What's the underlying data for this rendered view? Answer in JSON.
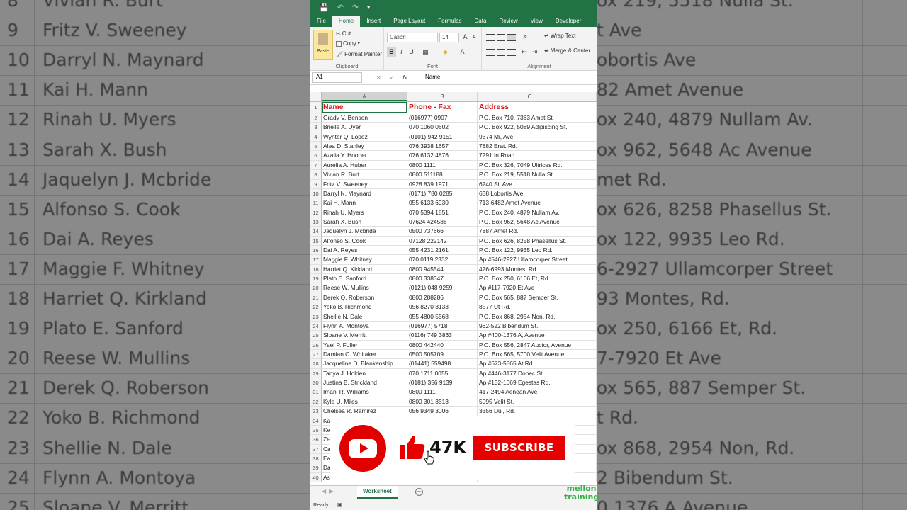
{
  "backdrop": {
    "left_rows": [
      {
        "num": "8",
        "name": "Vivian R. Burt"
      },
      {
        "num": "9",
        "name": "Fritz V. Sweeney"
      },
      {
        "num": "10",
        "name": "Darryl N. Maynard"
      },
      {
        "num": "11",
        "name": "Kai H. Mann"
      },
      {
        "num": "12",
        "name": "Rinah U. Myers"
      },
      {
        "num": "13",
        "name": "Sarah X. Bush"
      },
      {
        "num": "14",
        "name": "Jaquelyn J. Mcbride"
      },
      {
        "num": "15",
        "name": "Alfonso S. Cook"
      },
      {
        "num": "16",
        "name": "Dai A. Reyes"
      },
      {
        "num": "17",
        "name": "Maggie F. Whitney"
      },
      {
        "num": "18",
        "name": "Harriet Q. Kirkland"
      },
      {
        "num": "19",
        "name": "Plato E. Sanford"
      },
      {
        "num": "20",
        "name": "Reese W. Mullins"
      },
      {
        "num": "21",
        "name": "Derek Q. Roberson"
      },
      {
        "num": "22",
        "name": "Yoko B. Richmond"
      },
      {
        "num": "23",
        "name": "Shellie N. Dale"
      },
      {
        "num": "24",
        "name": "Flynn A. Montoya"
      },
      {
        "num": "25",
        "name": "Sloane V. Merritt"
      }
    ],
    "right_rows": [
      "ox 219, 5518 Nulla St.",
      "t Ave",
      "obortis Ave",
      "82 Amet Avenue",
      "ox 240, 4879 Nullam Av.",
      "ox 962, 5648 Ac Avenue",
      "met Rd.",
      "ox 626, 8258 Phasellus St.",
      "ox 122, 9935 Leo Rd.",
      "6-2927 Ullamcorper Street",
      "93 Montes, Rd.",
      "ox 250, 6166 Et, Rd.",
      "7-7920 Et Ave",
      "ox 565, 887 Semper St.",
      "t Rd.",
      "ox 868, 2954 Non, Rd.",
      "2 Bibendum St.",
      "0 1376 A Avenue"
    ]
  },
  "excel": {
    "tabs": [
      "File",
      "Home",
      "Insert",
      "Page Layout",
      "Formulas",
      "Data",
      "Review",
      "View",
      "Developer"
    ],
    "active_tab": "Home",
    "clipboard": {
      "paste": "Paste",
      "cut": "Cut",
      "copy": "Copy",
      "format_painter": "Format Painter",
      "label": "Clipboard"
    },
    "font": {
      "name": "Calibri",
      "size": "14",
      "label": "Font",
      "bold": "B",
      "italic": "I",
      "underline": "U"
    },
    "alignment": {
      "wrap": "Wrap Text",
      "merge": "Merge & Center",
      "label": "Alignment"
    },
    "namebox": "A1",
    "formula": "Name",
    "fx": "fx",
    "columns": [
      "A",
      "B",
      "C"
    ],
    "header_row": {
      "num": "1",
      "a": "Name",
      "b": "Phone - Fax",
      "c": "Address"
    },
    "rows": [
      {
        "num": "2",
        "a": "Grady V. Benson",
        "b": "(016977) 0907",
        "c": "P.O. Box 710, 7363 Amet St."
      },
      {
        "num": "3",
        "a": "Brielle A. Dyer",
        "b": "070 1060 0602",
        "c": "P.O. Box 922, 5089 Adipiscing St."
      },
      {
        "num": "4",
        "a": "Wynter Q. Lopez",
        "b": "(0101) 942 9151",
        "c": "9374 Mi, Ave"
      },
      {
        "num": "5",
        "a": "Alea D. Stanley",
        "b": "076 3938 1657",
        "c": "7882 Erat. Rd."
      },
      {
        "num": "6",
        "a": "Azalia Y. Hooper",
        "b": "076 6132 4876",
        "c": "7291 In Road"
      },
      {
        "num": "7",
        "a": "Aurelia A. Huber",
        "b": "0800 1111",
        "c": "P.O. Box 326, 7049 Ultrices Rd."
      },
      {
        "num": "8",
        "a": "Vivian R. Burt",
        "b": "0800 511188",
        "c": "P.O. Box 219, 5518 Nulla St."
      },
      {
        "num": "9",
        "a": "Fritz V. Sweeney",
        "b": "0928 839 1971",
        "c": "6240 Sit Ave"
      },
      {
        "num": "10",
        "a": "Darryl N. Maynard",
        "b": "(0171) 780 0285",
        "c": "638 Lobortis Ave"
      },
      {
        "num": "11",
        "a": "Kai H. Mann",
        "b": "055 6133 6930",
        "c": "713-6482 Amet Avenue"
      },
      {
        "num": "12",
        "a": "Rinah U. Myers",
        "b": "070 5394 1851",
        "c": "P.O. Box 240, 4879 Nullam Av."
      },
      {
        "num": "13",
        "a": "Sarah X. Bush",
        "b": "07624 424586",
        "c": "P.O. Box 962, 5648 Ac Avenue"
      },
      {
        "num": "14",
        "a": "Jaquelyn J. Mcbride",
        "b": "0500 737666",
        "c": "7887 Amet Rd."
      },
      {
        "num": "15",
        "a": "Alfonso S. Cook",
        "b": "07128 222142",
        "c": "P.O. Box 626, 8258 Phasellus St."
      },
      {
        "num": "16",
        "a": "Dai A. Reyes",
        "b": "055 4231 2161",
        "c": "P.O. Box 122, 9935 Leo Rd."
      },
      {
        "num": "17",
        "a": "Maggie F. Whitney",
        "b": "070 0119 2332",
        "c": "Ap #546-2927 Ullamcorper Street"
      },
      {
        "num": "18",
        "a": "Harriet Q. Kirkland",
        "b": "0800 945544",
        "c": "426-6993 Montes, Rd."
      },
      {
        "num": "19",
        "a": "Plato E. Sanford",
        "b": "0800 338347",
        "c": "P.O. Box 250, 6166 Et, Rd."
      },
      {
        "num": "20",
        "a": "Reese W. Mullins",
        "b": "(0121) 048 9259",
        "c": "Ap #117-7920 Et Ave"
      },
      {
        "num": "21",
        "a": "Derek Q. Roberson",
        "b": "0800 288286",
        "c": "P.O. Box 565, 887 Semper St."
      },
      {
        "num": "22",
        "a": "Yoko B. Richmond",
        "b": "056 8270 3133",
        "c": "8577 Ut Rd."
      },
      {
        "num": "23",
        "a": "Shellie N. Dale",
        "b": "055 4800 5568",
        "c": "P.O. Box 868, 2954 Non, Rd."
      },
      {
        "num": "24",
        "a": "Flynn A. Montoya",
        "b": "(016977) 5718",
        "c": "962-522 Bibendum St."
      },
      {
        "num": "25",
        "a": "Sloane V. Merritt",
        "b": "(0116) 749 3863",
        "c": "Ap #400-1376 A, Avenue"
      },
      {
        "num": "26",
        "a": "Yael P. Fuller",
        "b": "0800 442440",
        "c": "P.O. Box 556, 2847 Auctor, Avenue"
      },
      {
        "num": "27",
        "a": "Damian C. Whitaker",
        "b": "0500 505709",
        "c": "P.O. Box 565, 5700 Velit Avenue"
      },
      {
        "num": "28",
        "a": "Jacqueline D. Blankenship",
        "b": "(01441) 559498",
        "c": "Ap #673-5565 At Rd."
      },
      {
        "num": "29",
        "a": "Tanya J. Holden",
        "b": "070 1711 0055",
        "c": "Ap #446-3177 Donec St."
      },
      {
        "num": "30",
        "a": "Justina B. Strickland",
        "b": "(0181) 356 9139",
        "c": "Ap #132-1669 Egestas Rd."
      },
      {
        "num": "31",
        "a": "Imani R. Williams",
        "b": "0800 1111",
        "c": "417-2494 Aenean Ave"
      },
      {
        "num": "32",
        "a": "Kyle U. Miles",
        "b": "0800 301 3513",
        "c": "5095 Velit St."
      },
      {
        "num": "33",
        "a": "Chelsea R. Ramirez",
        "b": "056 9349 3006",
        "c": "3356 Dui, Rd."
      },
      {
        "num": "34",
        "a": "Kat",
        "b": "",
        "c": ""
      },
      {
        "num": "35",
        "a": "Ke",
        "b": "",
        "c": ""
      },
      {
        "num": "36",
        "a": "Ze",
        "b": "",
        "c": ""
      },
      {
        "num": "37",
        "a": "Ca",
        "b": "",
        "c": ""
      },
      {
        "num": "38",
        "a": "Ea",
        "b": "",
        "c": ""
      },
      {
        "num": "39",
        "a": "Da",
        "b": "",
        "c": ""
      },
      {
        "num": "40",
        "a": "Ash",
        "b": "",
        "c": ""
      }
    ],
    "sheet_tab": "Worksheet",
    "add_sheet": "+",
    "status": "Ready"
  },
  "overlay": {
    "likes": "47K",
    "subscribe": "SUBSCRIBE",
    "watermark_line1": "mellon",
    "watermark_line2": "training"
  },
  "colors": {
    "excel_green": "#217346",
    "header_red": "#d11a1a",
    "youtube_red": "#e00000"
  }
}
